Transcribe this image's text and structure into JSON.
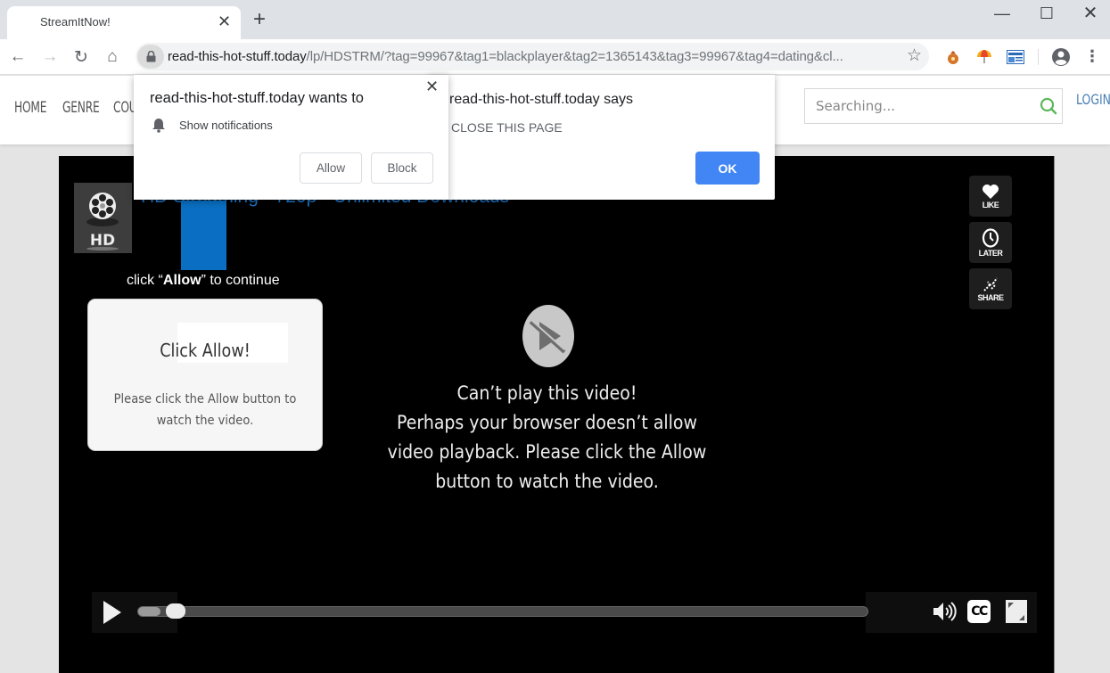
{
  "browser": {
    "tab": {
      "title": "StreamItNow!",
      "close_icon": "close-icon"
    },
    "new_tab_label": "+",
    "window_controls": {
      "minimize": "—",
      "maximize": "☐",
      "close": "✕"
    },
    "nav": {
      "back": "←",
      "forward": "→",
      "reload": "↻",
      "home": "⌂"
    },
    "url": {
      "host": "read-this-hot-stuff.today",
      "path": "/lp/HDSTRM/?tag=99967&tag1=blackplayer&tag2=1365143&tag3=99967&tag4=dating&cl..."
    },
    "star_icon": "☆",
    "menu_icon": "⋮"
  },
  "site": {
    "nav": [
      {
        "label": "HOME"
      },
      {
        "label": "GENRE"
      },
      {
        "label": "COUNTRY"
      }
    ],
    "search": {
      "placeholder": "Searching..."
    },
    "login_label": "LOGIN",
    "accent_color": "#4a7fb5"
  },
  "player": {
    "title": "HD Streaming · 720p · Unlimited Downloads",
    "hd_label": "HD",
    "click_allow": {
      "prefix": "click “",
      "strong": "Allow",
      "suffix": "” to continue"
    },
    "card": {
      "title": "Click Allow!",
      "body": "Please click the Allow button to watch the video."
    },
    "error": {
      "heading": "Can’t play this video!",
      "body": "Perhaps your browser doesn’t allow video playback. Please click the Allow button to watch the video."
    },
    "side_actions": [
      {
        "label": "LIKE",
        "icon": "heart-icon"
      },
      {
        "label": "LATER",
        "icon": "clock-icon"
      },
      {
        "label": "SHARE",
        "icon": "share-icon"
      }
    ],
    "progress": 0.03,
    "cc_label": "CC"
  },
  "alert_dialog": {
    "title": "read-this-hot-stuff.today says",
    "message": "CLOSE THIS PAGE",
    "ok_label": "OK",
    "ok_color": "#4285f4"
  },
  "permission_dialog": {
    "title": "read-this-hot-stuff.today wants to",
    "permission": "Show notifications",
    "allow_label": "Allow",
    "block_label": "Block",
    "close_label": "✕"
  }
}
